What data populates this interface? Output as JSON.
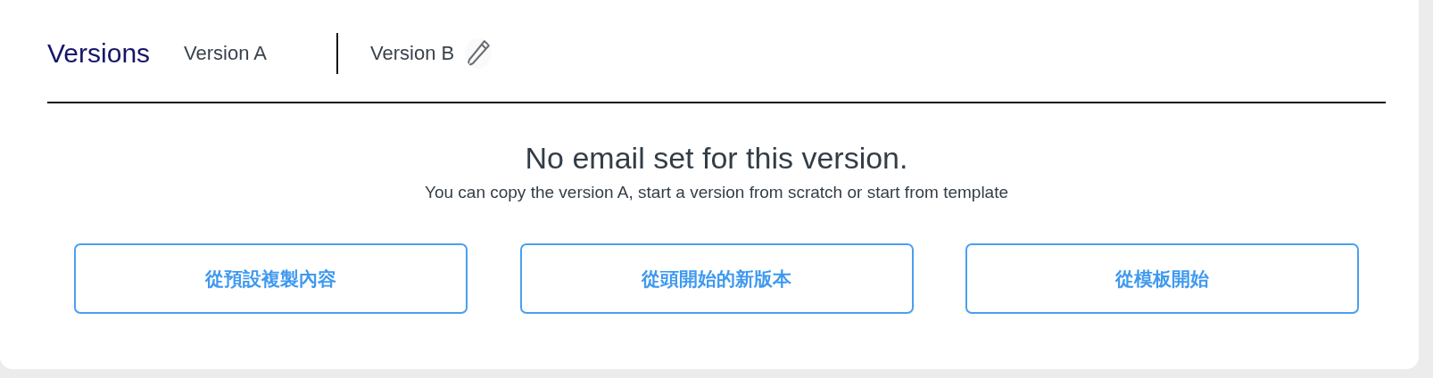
{
  "header": {
    "title": "Versions"
  },
  "tabs": [
    {
      "label": "Version A",
      "editable": false
    },
    {
      "label": "Version B",
      "editable": true
    }
  ],
  "empty_state": {
    "heading": "No email set for this version.",
    "message": "You can copy the version A, start a version from scratch or start from template"
  },
  "buttons": [
    "從預設複製內容",
    "從頭開始的新版本",
    "從模板開始"
  ]
}
